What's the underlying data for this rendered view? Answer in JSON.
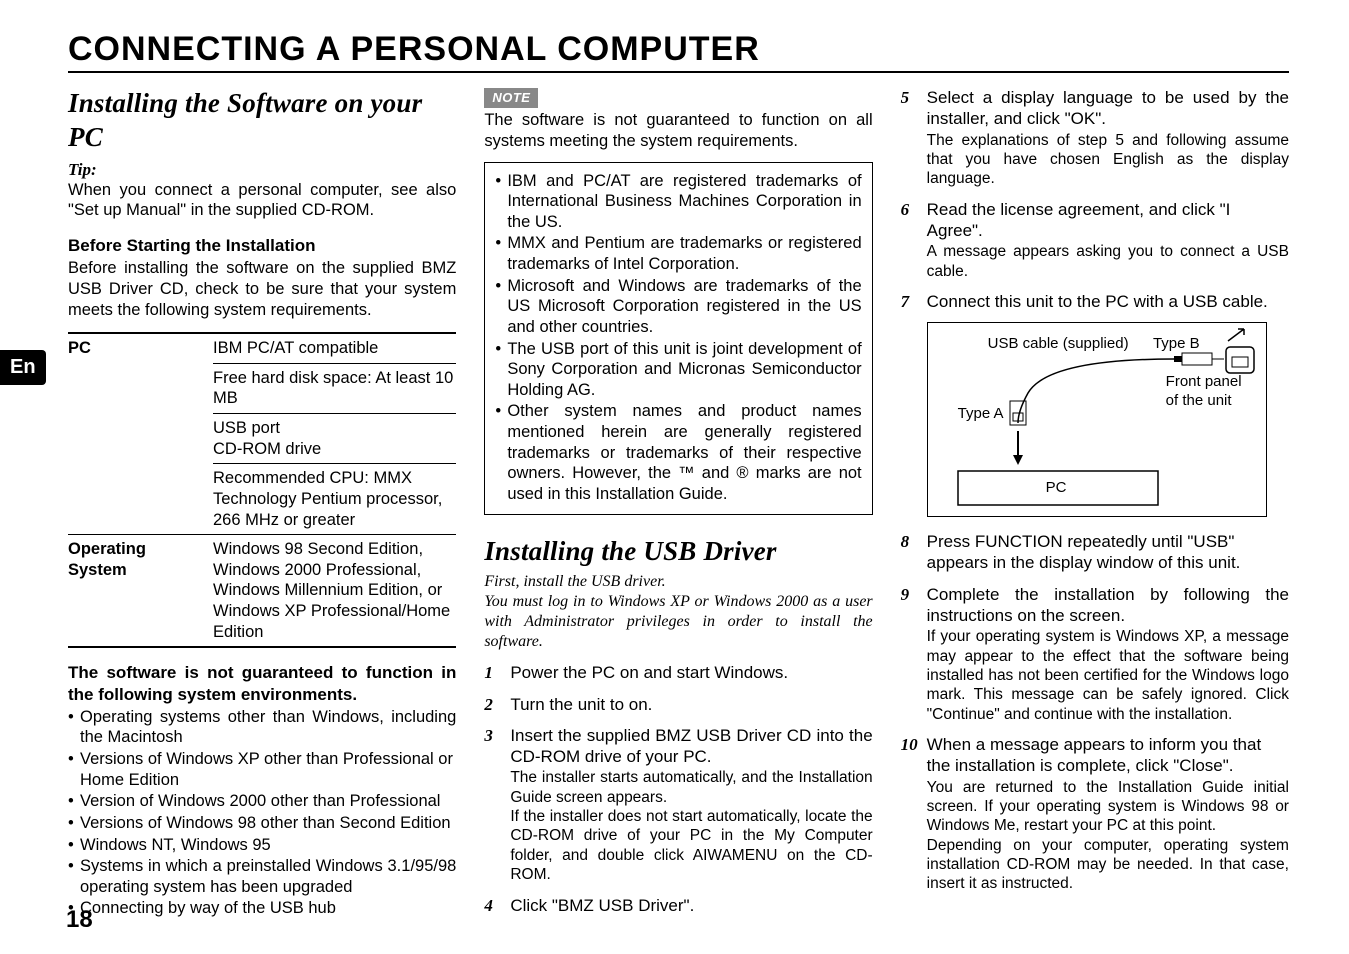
{
  "lang_tab": "En",
  "page_title": "CONNECTING A PERSONAL COMPUTER",
  "page_number": "18",
  "col1": {
    "h_install_sw": "Installing the Software on your PC",
    "tip_label": "Tip:",
    "tip_text": "When you connect a personal computer, see also \"Set up Manual\" in the supplied CD-ROM.",
    "before_head": "Before Starting the Installation",
    "before_text": "Before installing the software on the supplied BMZ USB Driver CD, check to be sure that your system meets the following system requirements.",
    "table": {
      "rows": [
        {
          "label": "PC",
          "cells": [
            "IBM PC/AT compatible",
            "Free hard disk space: At least 10 MB",
            "USB port\nCD-ROM drive",
            "Recommended CPU: MMX Technology Pentium processor, 266 MHz or greater"
          ]
        },
        {
          "label": "Operating System",
          "cells": [
            "Windows 98 Second Edition, Windows 2000 Professional, Windows Millennium Edition, or Windows XP Professional/Home Edition"
          ]
        }
      ]
    },
    "not_guaranteed_head": "The software is not guaranteed to function in the following system environments.",
    "not_guaranteed_items": [
      "Operating systems other than Windows, including the Macintosh",
      "Versions of Windows XP other than Professional or Home Edition",
      "Version of Windows 2000 other than Professional",
      "Versions of Windows 98 other than Second Edition",
      "Windows NT, Windows 95",
      "Systems in which a preinstalled Windows 3.1/95/98 operating system has been upgraded",
      "Connecting by way of the USB hub"
    ]
  },
  "col2": {
    "note_label": "NOTE",
    "note_text": "The software is not guaranteed to function on all systems meeting the system requirements.",
    "trademark_items": [
      "IBM and PC/AT are registered trademarks of International Business Machines Corporation in the US.",
      "MMX and Pentium are trademarks or registered trademarks of Intel Corporation.",
      "Microsoft and Windows are trademarks of the US Microsoft Corporation registered in the US and other countries.",
      "The USB port of this unit is joint development of Sony Corporation and Micronas Semiconductor Holding AG.",
      "Other system names and product names mentioned herein are generally registered trademarks or trademarks of their respective owners. However, the ™ and ® marks are not used in this Installation Guide."
    ],
    "h_usb": "Installing the USB Driver",
    "usb_intro1": "First, install the USB driver.",
    "usb_intro2": "You must log in to Windows XP or Windows 2000 as a user with Administrator privileges in order to install the software.",
    "steps": [
      {
        "n": "1",
        "main": "Power the PC on and start Windows."
      },
      {
        "n": "2",
        "main": "Turn the unit to on."
      },
      {
        "n": "3",
        "main": "Insert the supplied BMZ USB Driver CD into the CD-ROM drive of your PC.",
        "sub": "The installer starts automatically, and the Installation Guide screen appears.\nIf the installer does not start automatically, locate the CD-ROM drive of your PC in the My Computer folder, and double click AIWAMENU on the CD-ROM."
      },
      {
        "n": "4",
        "main": "Click \"BMZ USB Driver\"."
      }
    ]
  },
  "col3": {
    "steps": [
      {
        "n": "5",
        "main": "Select a display language to be used by the installer, and click \"OK\".",
        "sub": "The explanations of step 5 and following assume that you have chosen English as the display language."
      },
      {
        "n": "6",
        "main": "Read the license agreement, and click \"I Agree\".",
        "sub": "A message appears asking you to connect a USB cable."
      },
      {
        "n": "7",
        "main": "Connect this unit to the PC with a USB cable."
      }
    ],
    "diagram": {
      "usb_cable": "USB cable (supplied)",
      "type_b": "Type B",
      "type_a": "Type A",
      "front_panel": "Front panel of the unit",
      "pc": "PC"
    },
    "steps2": [
      {
        "n": "8",
        "main": "Press FUNCTION repeatedly until \"USB\" appears in the display window of this unit."
      },
      {
        "n": "9",
        "main": "Complete the installation by following the instructions on the screen.",
        "sub": "If your operating system is Windows XP, a message may appear to the effect that the software being installed has not been certified for the Windows logo mark. This message can be safely ignored. Click \"Continue\" and continue with the installation."
      },
      {
        "n": "10",
        "main": "When a message appears to inform you that the installation is complete, click \"Close\".",
        "sub": "You are returned to the Installation Guide initial screen. If your operating system is Windows 98 or Windows Me, restart your PC at this point.\nDepending on your computer, operating system installation CD-ROM may be needed. In that case, insert it as instructed."
      }
    ]
  }
}
